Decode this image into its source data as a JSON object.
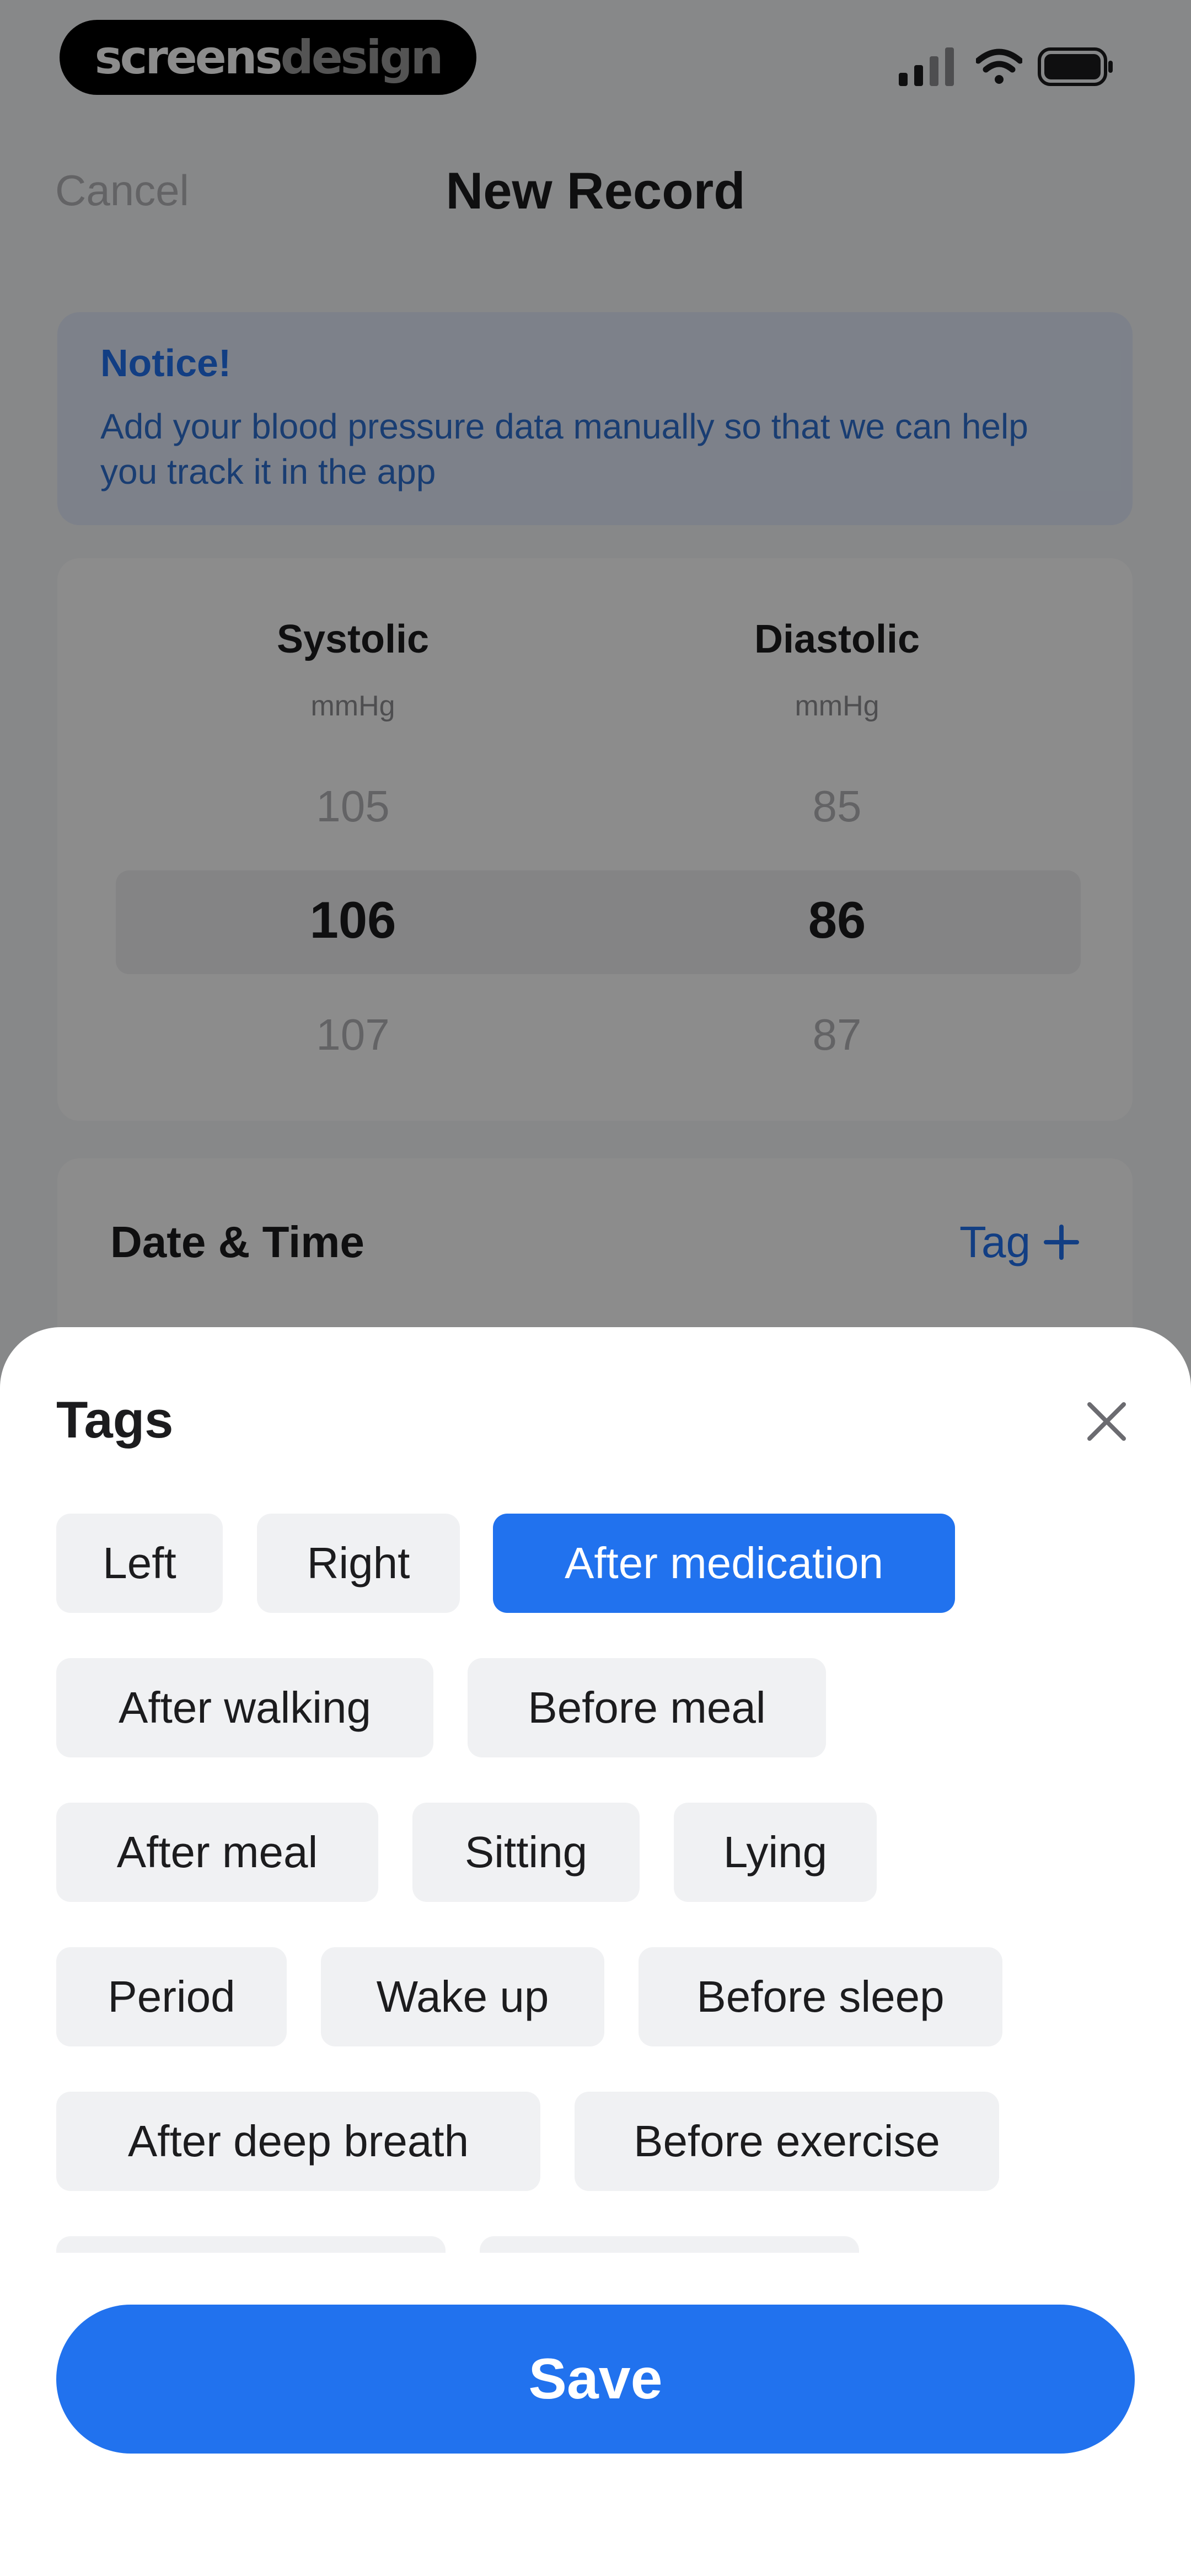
{
  "status_bar": {
    "brand_part1": "screens",
    "brand_part2": "design",
    "icons": [
      "signal-icon",
      "wifi-icon",
      "battery-icon"
    ]
  },
  "nav": {
    "cancel_label": "Cancel",
    "title": "New Record"
  },
  "notice": {
    "title": "Notice!",
    "body": "Add your blood pressure data manually so that we can help you track it in the app"
  },
  "picker": {
    "systolic": {
      "label": "Systolic",
      "unit": "mmHg",
      "values": [
        "105",
        "106",
        "107"
      ],
      "selected": "106"
    },
    "diastolic": {
      "label": "Diastolic",
      "unit": "mmHg",
      "values": [
        "85",
        "86",
        "87"
      ],
      "selected": "86"
    }
  },
  "datetime": {
    "label": "Date & Time",
    "tag_label": "Tag"
  },
  "tags_sheet": {
    "title": "Tags",
    "tags": [
      {
        "label": "Left",
        "selected": false
      },
      {
        "label": "Right",
        "selected": false
      },
      {
        "label": "After medication",
        "selected": true
      },
      {
        "label": "After walking",
        "selected": false
      },
      {
        "label": "Before meal",
        "selected": false
      },
      {
        "label": "After meal",
        "selected": false
      },
      {
        "label": "Sitting",
        "selected": false
      },
      {
        "label": "Lying",
        "selected": false
      },
      {
        "label": "Period",
        "selected": false
      },
      {
        "label": "Wake up",
        "selected": false
      },
      {
        "label": "Before sleep",
        "selected": false
      },
      {
        "label": "After deep breath",
        "selected": false
      },
      {
        "label": "Before exercise",
        "selected": false
      }
    ],
    "save_label": "Save"
  },
  "colors": {
    "accent": "#2172ee",
    "chip_bg": "#f0f1f3",
    "notice_bg": "#e3ecfb"
  }
}
